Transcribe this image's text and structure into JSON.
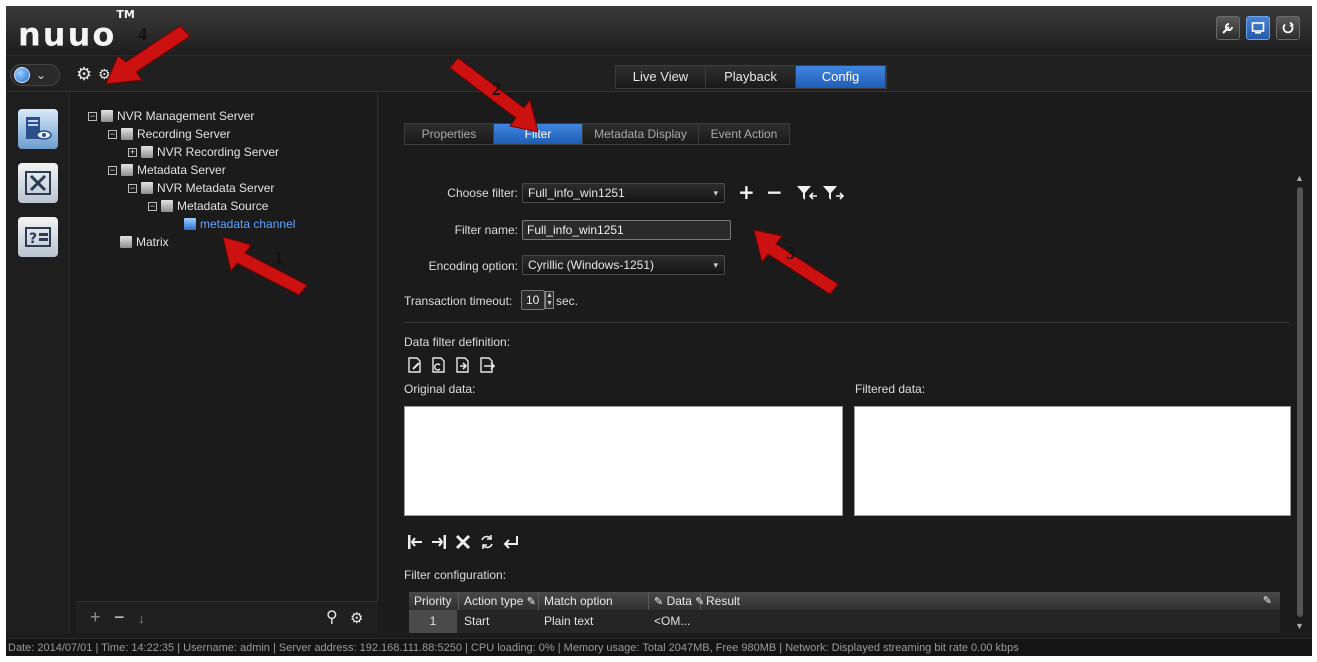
{
  "app": {
    "logo": "nuuo",
    "logo_tm": "TM",
    "window_buttons": [
      "wrench-icon",
      "monitor-icon",
      "power-icon"
    ]
  },
  "toolbar": {
    "globe_caret": "⌄",
    "main_tabs": [
      {
        "label": "Live View",
        "active": false
      },
      {
        "label": "Playback",
        "active": false
      },
      {
        "label": "Config",
        "active": true
      }
    ]
  },
  "tree": {
    "items": [
      {
        "label": "NVR Management Server",
        "expander": "−"
      },
      {
        "label": "Recording Server",
        "expander": "−"
      },
      {
        "label": "NVR Recording Server",
        "expander": "+"
      },
      {
        "label": "Metadata Server",
        "expander": "−"
      },
      {
        "label": "NVR Metadata Server",
        "expander": "−"
      },
      {
        "label": "Metadata Source",
        "expander": "−"
      },
      {
        "label": "metadata channel",
        "expander": ""
      },
      {
        "label": "Matrix",
        "expander": ""
      }
    ]
  },
  "config": {
    "sub_tabs": [
      {
        "label": "Properties",
        "active": false
      },
      {
        "label": "Filter",
        "active": true
      },
      {
        "label": "Metadata Display",
        "active": false
      },
      {
        "label": "Event Action",
        "active": false
      }
    ],
    "choose_filter": {
      "label": "Choose filter:",
      "value": "Full_info_win1251"
    },
    "filter_name": {
      "label": "Filter name:",
      "value": "Full_info_win1251"
    },
    "encoding": {
      "label": "Encoding option:",
      "value": "Cyrillic (Windows-1251)"
    },
    "timeout": {
      "label": "Transaction timeout:",
      "value": "10",
      "unit": "sec."
    },
    "data_filter_label": "Data filter definition:",
    "original_label": "Original data:",
    "filtered_label": "Filtered data:",
    "filter_config_label": "Filter configuration:",
    "grid": {
      "columns": [
        "Priority",
        "Action type",
        "Match option",
        "Data",
        "Result"
      ],
      "rows": [
        {
          "priority": "1",
          "action": "Start",
          "match": "Plain text",
          "data": "<OM..."
        }
      ]
    }
  },
  "annotations": [
    "1",
    "2",
    "3",
    "4"
  ],
  "status": {
    "text": "Date: 2014/07/01  |  Time: 14:22:35  |  Username: admin  |  Server address: 192.168.111.88:5250  |  CPU loading: 0%  |  Memory usage: Total 2047MB, Free 980MB  |  Network: Displayed streaming bit rate    0.00 kbps"
  }
}
